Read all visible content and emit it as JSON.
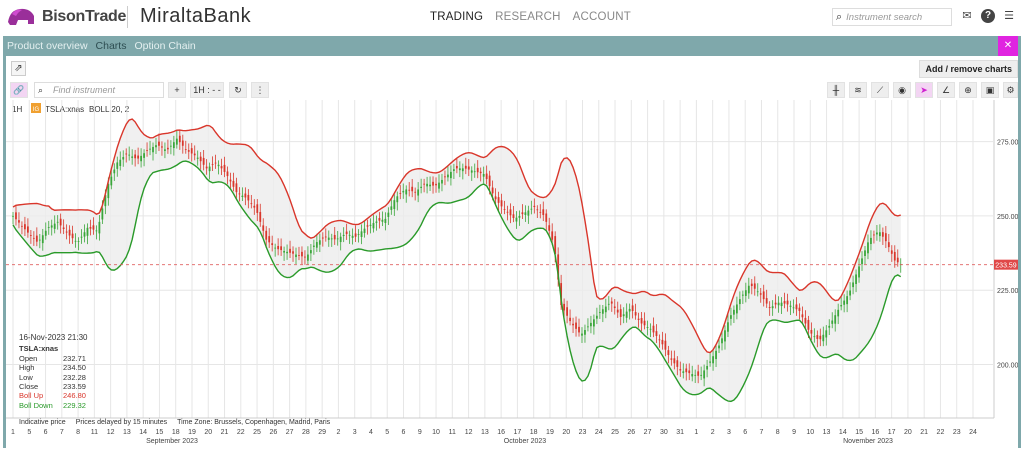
{
  "header": {
    "logo1": "BisonTrade",
    "logo2": "MiraltaBank",
    "nav": [
      {
        "label": "TRADING",
        "active": true
      },
      {
        "label": "RESEARCH",
        "active": false
      },
      {
        "label": "ACCOUNT",
        "active": false
      }
    ],
    "search_placeholder": "Instrument search"
  },
  "tabs": [
    {
      "label": "Product overview",
      "active": false
    },
    {
      "label": "Charts",
      "active": true
    },
    {
      "label": "Option Chain",
      "active": false
    }
  ],
  "toolbar": {
    "add_remove": "Add / remove charts",
    "find_placeholder": "Find instrument",
    "plus": "+",
    "interval": "1H : - -",
    "refresh": "↻",
    "more": "⋮"
  },
  "chart_header": {
    "interval": "1H",
    "badge": "IG",
    "symbol": "TSLA:xnas",
    "indicator": "BOLL 20, 2"
  },
  "info_panel": {
    "datetime": "16-Nov-2023 21:30",
    "symbol": "TSLA:xnas",
    "rows": [
      {
        "label": "Open",
        "value": "232.71",
        "style": ""
      },
      {
        "label": "High",
        "value": "234.50",
        "style": ""
      },
      {
        "label": "Low",
        "value": "232.28",
        "style": ""
      },
      {
        "label": "Close",
        "value": "233.59",
        "style": ""
      },
      {
        "label": "Boll Up",
        "value": "246.80",
        "style": "red"
      },
      {
        "label": "Boll Down",
        "value": "229.32",
        "style": "green"
      }
    ]
  },
  "footer": {
    "indicative": "Indicative price",
    "delay": "Prices delayed by 15 minutes",
    "timezone": "Time Zone: Brussels, Copenhagen, Madrid, Paris"
  },
  "colors": {
    "accent": "#7fa8ab",
    "pink": "#e024e0",
    "boll_up": "#d9362b",
    "boll_down": "#2a9a2a",
    "up_candle": "#3aa63a",
    "down_candle": "#d9362b"
  },
  "chart_data": {
    "type": "candlestick",
    "symbol": "TSLA:xnas",
    "price_label": "233.59",
    "ylim": [
      182,
      289
    ],
    "yticks": [
      200,
      225,
      250,
      275
    ],
    "ytick_labels": [
      "200.00",
      "225.00",
      "250.00",
      "275.00"
    ],
    "xticks": [
      "1",
      "5",
      "6",
      "7",
      "8",
      "11",
      "12",
      "13",
      "14",
      "15",
      "18",
      "19",
      "20",
      "21",
      "22",
      "25",
      "26",
      "27",
      "28",
      "29",
      "2",
      "3",
      "4",
      "5",
      "6",
      "9",
      "10",
      "11",
      "12",
      "13",
      "16",
      "17",
      "18",
      "19",
      "20",
      "23",
      "24",
      "25",
      "26",
      "27",
      "30",
      "31",
      "1",
      "2",
      "3",
      "6",
      "7",
      "8",
      "9",
      "10",
      "13",
      "14",
      "15",
      "16",
      "17",
      "20",
      "21",
      "22",
      "23",
      "24"
    ],
    "month_labels": [
      "September 2023",
      "October 2023",
      "November 2023"
    ],
    "close_series": [
      [
        0,
        250
      ],
      [
        8,
        247
      ],
      [
        16,
        244
      ],
      [
        25,
        241
      ],
      [
        35,
        246
      ],
      [
        45,
        248
      ],
      [
        55,
        244
      ],
      [
        65,
        241
      ],
      [
        75,
        246
      ],
      [
        85,
        245
      ],
      [
        95,
        260
      ],
      [
        105,
        268
      ],
      [
        115,
        271
      ],
      [
        125,
        269
      ],
      [
        135,
        272
      ],
      [
        145,
        274
      ],
      [
        155,
        272
      ],
      [
        165,
        276
      ],
      [
        175,
        272
      ],
      [
        185,
        270
      ],
      [
        195,
        266
      ],
      [
        205,
        268
      ],
      [
        215,
        264
      ],
      [
        225,
        258
      ],
      [
        235,
        256
      ],
      [
        245,
        252
      ],
      [
        255,
        242
      ],
      [
        265,
        239
      ],
      [
        275,
        238
      ],
      [
        285,
        237
      ],
      [
        295,
        236
      ],
      [
        305,
        241
      ],
      [
        315,
        243
      ],
      [
        325,
        242
      ],
      [
        335,
        244
      ],
      [
        345,
        243
      ],
      [
        355,
        246
      ],
      [
        365,
        248
      ],
      [
        375,
        249
      ],
      [
        385,
        256
      ],
      [
        395,
        259
      ],
      [
        405,
        258
      ],
      [
        415,
        261
      ],
      [
        425,
        260
      ],
      [
        435,
        263
      ],
      [
        445,
        266
      ],
      [
        455,
        266
      ],
      [
        465,
        265
      ],
      [
        475,
        264
      ],
      [
        485,
        256
      ],
      [
        495,
        252
      ],
      [
        505,
        249
      ],
      [
        515,
        251
      ],
      [
        525,
        253
      ],
      [
        535,
        250
      ],
      [
        545,
        240
      ],
      [
        552,
        220
      ],
      [
        562,
        214
      ],
      [
        572,
        210
      ],
      [
        582,
        214
      ],
      [
        592,
        218
      ],
      [
        602,
        221
      ],
      [
        612,
        216
      ],
      [
        622,
        219
      ],
      [
        632,
        214
      ],
      [
        642,
        212
      ],
      [
        652,
        208
      ],
      [
        662,
        202
      ],
      [
        672,
        198
      ],
      [
        682,
        197
      ],
      [
        692,
        196
      ],
      [
        702,
        201
      ],
      [
        712,
        207
      ],
      [
        722,
        216
      ],
      [
        732,
        222
      ],
      [
        742,
        227
      ],
      [
        752,
        224
      ],
      [
        762,
        219
      ],
      [
        772,
        221
      ],
      [
        782,
        220
      ],
      [
        792,
        218
      ],
      [
        802,
        211
      ],
      [
        812,
        208
      ],
      [
        822,
        213
      ],
      [
        832,
        219
      ],
      [
        842,
        224
      ],
      [
        852,
        233
      ],
      [
        862,
        242
      ],
      [
        872,
        245
      ],
      [
        880,
        241
      ],
      [
        888,
        235
      ],
      [
        895,
        233.59
      ]
    ],
    "boll_up": [
      246.8
    ],
    "boll_down": [
      229.32
    ]
  }
}
